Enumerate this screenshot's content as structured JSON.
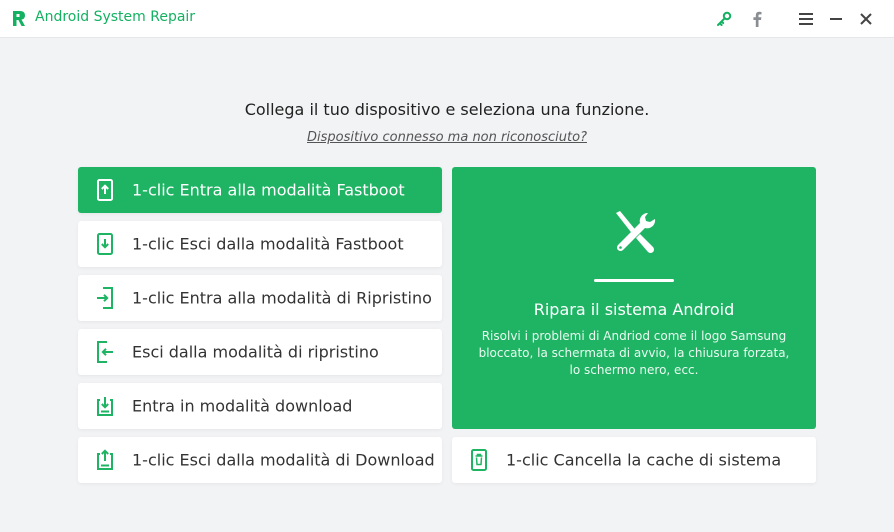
{
  "app": {
    "title": "Android System Repair",
    "brand_color": "#1fb464"
  },
  "titlebar": {
    "icons": [
      "key-icon",
      "facebook-icon",
      "menu-icon",
      "minimize-icon",
      "close-icon"
    ]
  },
  "main": {
    "heading": "Collega il tuo dispositivo e seleziona una funzione.",
    "unrecognized_link": "Dispositivo connesso ma non riconosciuto?"
  },
  "options": [
    {
      "label": "1-clic Entra alla modalità Fastboot",
      "icon": "phone-upload-icon",
      "active": true
    },
    {
      "label": "1-clic Esci dalla modalità Fastboot",
      "icon": "phone-download-icon",
      "active": false
    },
    {
      "label": "1-clic Entra alla modalità di Ripristino",
      "icon": "phone-enter-icon",
      "active": false
    },
    {
      "label": "Esci dalla modalità di ripristino",
      "icon": "phone-exit-icon",
      "active": false
    },
    {
      "label": "Entra in modalità download",
      "icon": "tray-download-icon",
      "active": false
    },
    {
      "label": "1-clic Esci dalla modalità di Download",
      "icon": "tray-upload-icon",
      "active": false
    }
  ],
  "repair": {
    "title": "Ripara il sistema Android",
    "description": "Risolvi i problemi di Andriod come il logo Samsung bloccato, la schermata di avvio, la chiusura forzata, lo schermo nero, ecc.",
    "icon": "repair-tools-icon"
  },
  "cache": {
    "label": "1-clic Cancella la cache di sistema",
    "icon": "phone-trash-icon"
  }
}
